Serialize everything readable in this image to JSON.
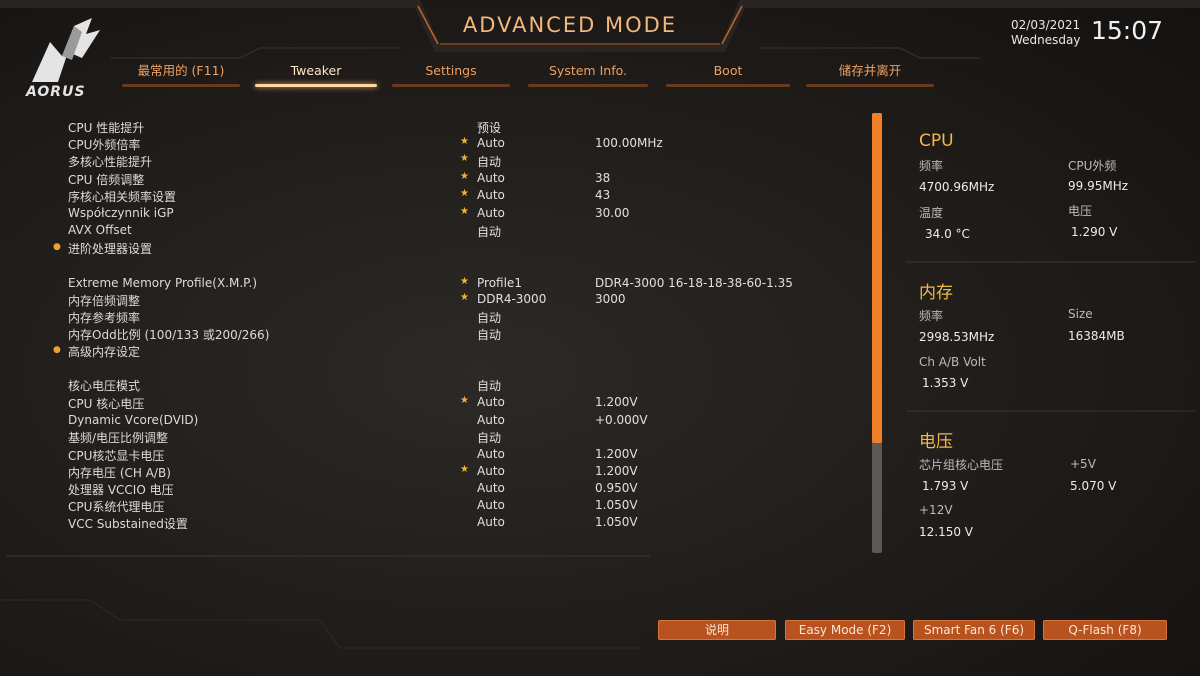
{
  "header": {
    "brand": "AORUS",
    "mode_title": "ADVANCED MODE",
    "date": "02/03/2021",
    "weekday": "Wednesday",
    "time": "15:07"
  },
  "tabs": [
    {
      "label": "最常用的 (F11)",
      "active": false
    },
    {
      "label": "Tweaker",
      "active": true
    },
    {
      "label": "Settings",
      "active": false
    },
    {
      "label": "System Info.",
      "active": false
    },
    {
      "label": "Boot",
      "active": false
    },
    {
      "label": "储存并离开",
      "active": false
    }
  ],
  "settings": [
    {
      "label": "CPU 性能提升",
      "value": "预设",
      "value2": "",
      "star": false,
      "sub": false
    },
    {
      "label": "CPU外频倍率",
      "value": "Auto",
      "value2": "100.00MHz",
      "star": true,
      "sub": false
    },
    {
      "label": "多核心性能提升",
      "value": "自动",
      "value2": "",
      "star": true,
      "sub": false
    },
    {
      "label": "CPU 倍频调整",
      "value": "Auto",
      "value2": "38",
      "star": true,
      "sub": false
    },
    {
      "label": "序核心相关频率设置",
      "value": "Auto",
      "value2": "43",
      "star": true,
      "sub": false
    },
    {
      "label": "Współczynnik iGP",
      "value": "Auto",
      "value2": "30.00",
      "star": true,
      "sub": false
    },
    {
      "label": "AVX Offset",
      "value": "自动",
      "value2": "",
      "star": false,
      "sub": false
    },
    {
      "label": "进阶处理器设置",
      "value": "",
      "value2": "",
      "star": false,
      "sub": true
    },
    {
      "label": "Extreme Memory Profile(X.M.P.)",
      "value": "Profile1",
      "value2": "DDR4-3000 16-18-18-38-60-1.35",
      "star": true,
      "sub": false
    },
    {
      "label": "内存倍频调整",
      "value": "DDR4-3000",
      "value2": "3000",
      "star": true,
      "sub": false
    },
    {
      "label": "内存参考频率",
      "value": "自动",
      "value2": "",
      "star": false,
      "sub": false
    },
    {
      "label": "内存Odd比例 (100/133 或200/266)",
      "value": "自动",
      "value2": "",
      "star": false,
      "sub": false
    },
    {
      "label": "高级内存设定",
      "value": "",
      "value2": "",
      "star": false,
      "sub": true
    },
    {
      "label": "核心电压模式",
      "value": "自动",
      "value2": "",
      "star": false,
      "sub": false
    },
    {
      "label": "CPU 核心电压",
      "value": "Auto",
      "value2": "1.200V",
      "star": true,
      "sub": false
    },
    {
      "label": "Dynamic Vcore(DVID)",
      "value": "Auto",
      "value2": "+0.000V",
      "star": false,
      "sub": false
    },
    {
      "label": "基频/电压比例调整",
      "value": "自动",
      "value2": "",
      "star": false,
      "sub": false
    },
    {
      "label": "CPU核芯显卡电压",
      "value": "Auto",
      "value2": "1.200V",
      "star": false,
      "sub": false
    },
    {
      "label": "内存电压 (CH A/B)",
      "value": "Auto",
      "value2": "1.200V",
      "star": true,
      "sub": false
    },
    {
      "label": "处理器 VCCIO 电压",
      "value": "Auto",
      "value2": "0.950V",
      "star": false,
      "sub": false
    },
    {
      "label": "CPU系统代理电压",
      "value": "Auto",
      "value2": "1.050V",
      "star": false,
      "sub": false
    },
    {
      "label": "VCC Substained设置",
      "value": "Auto",
      "value2": "1.050V",
      "star": false,
      "sub": false
    }
  ],
  "panel": {
    "cpu": {
      "title": "CPU",
      "freq_label": "频率",
      "freq": "4700.96MHz",
      "bclk_label": "CPU外频",
      "bclk": "99.95MHz",
      "temp_label": "温度",
      "temp": "34.0 °C",
      "volt_label": "电压",
      "volt": "1.290 V"
    },
    "memory": {
      "title": "内存",
      "freq_label": "频率",
      "freq": "2998.53MHz",
      "size_label": "Size",
      "size": "16384MB",
      "volt_label": "Ch A/B Volt",
      "volt": "1.353 V"
    },
    "voltage": {
      "title": "电压",
      "chipset_label": "芯片组核心电压",
      "chipset": "1.793 V",
      "v5_label": "+5V",
      "v5": "5.070 V",
      "v12_label": "+12V",
      "v12": "12.150 V"
    }
  },
  "scrollbar": {
    "thumb_fraction": 0.75
  },
  "buttons": [
    {
      "label": "说明"
    },
    {
      "label": "Easy Mode (F2)"
    },
    {
      "label": "Smart Fan 6 (F6)"
    },
    {
      "label": "Q-Flash (F8)"
    }
  ],
  "colors": {
    "accent": "#f07f2a",
    "title": "#f4b77a",
    "section_head": "#f0b84a",
    "background": "#1f1c1a"
  }
}
